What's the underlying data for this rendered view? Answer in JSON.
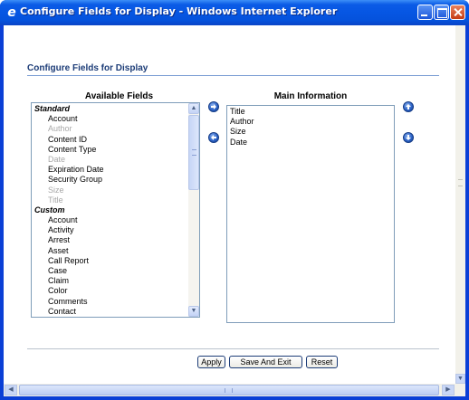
{
  "window": {
    "title": "Configure Fields for Display - Windows Internet Explorer"
  },
  "page": {
    "title": "Configure Fields for Display"
  },
  "available": {
    "heading": "Available Fields",
    "rows": [
      {
        "text": "Standard",
        "kind": "header"
      },
      {
        "text": "Account",
        "kind": "item"
      },
      {
        "text": "Author",
        "kind": "disabled"
      },
      {
        "text": "Content ID",
        "kind": "item"
      },
      {
        "text": "Content Type",
        "kind": "item"
      },
      {
        "text": "Date",
        "kind": "disabled"
      },
      {
        "text": "Expiration Date",
        "kind": "item"
      },
      {
        "text": "Security Group",
        "kind": "item"
      },
      {
        "text": "Size",
        "kind": "disabled"
      },
      {
        "text": "Title",
        "kind": "disabled"
      },
      {
        "text": "Custom",
        "kind": "header"
      },
      {
        "text": "Account",
        "kind": "item"
      },
      {
        "text": "Activity",
        "kind": "item"
      },
      {
        "text": "Arrest",
        "kind": "item"
      },
      {
        "text": "Asset",
        "kind": "item"
      },
      {
        "text": "Call Report",
        "kind": "item"
      },
      {
        "text": "Case",
        "kind": "item"
      },
      {
        "text": "Claim",
        "kind": "item"
      },
      {
        "text": "Color",
        "kind": "item"
      },
      {
        "text": "Comments",
        "kind": "item"
      },
      {
        "text": "Contact",
        "kind": "item"
      }
    ]
  },
  "main": {
    "heading": "Main Information",
    "rows": [
      "Title",
      "Author",
      "Size",
      "Date"
    ]
  },
  "buttons": {
    "apply": "Apply",
    "save_and_exit": "Save And Exit",
    "reset": "Reset"
  },
  "icons": {
    "add": "arrow-right-circle-icon",
    "remove": "arrow-left-circle-icon",
    "move_up": "arrow-up-circle-icon",
    "move_down": "arrow-down-circle-icon"
  },
  "colors": {
    "titlebar": "#0656e3",
    "page_title": "#1c3c77",
    "rule": "#7c9ed4",
    "disabled_text": "#a8a8a8"
  }
}
